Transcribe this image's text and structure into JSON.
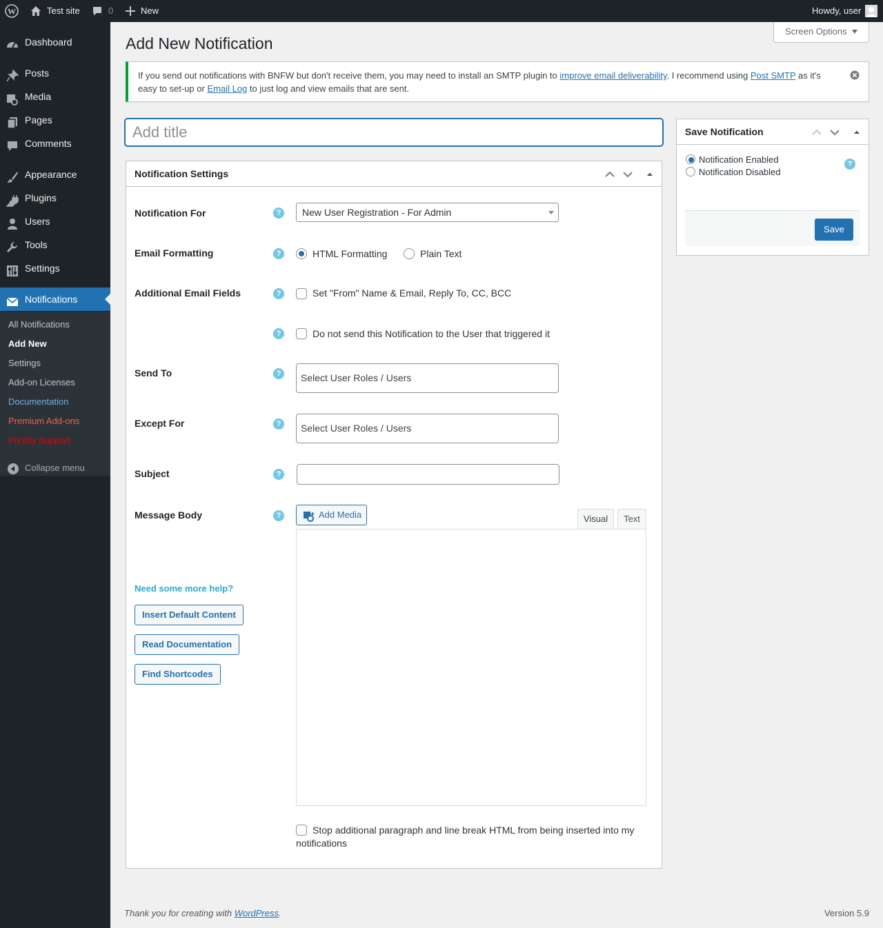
{
  "admin_bar": {
    "wp_logo_icon": "wordpress-icon",
    "site_name": "Test site",
    "comments_count": "0",
    "new_label": "New",
    "greeting": "Howdy, user"
  },
  "sidebar": {
    "items": [
      {
        "label": "Dashboard",
        "icon": "dashboard-icon"
      },
      {
        "label": "Posts",
        "icon": "pin-icon"
      },
      {
        "label": "Media",
        "icon": "media-icon"
      },
      {
        "label": "Pages",
        "icon": "pages-icon"
      },
      {
        "label": "Comments",
        "icon": "comment-icon"
      },
      {
        "label": "Appearance",
        "icon": "brush-icon"
      },
      {
        "label": "Plugins",
        "icon": "plugin-icon"
      },
      {
        "label": "Users",
        "icon": "user-icon"
      },
      {
        "label": "Tools",
        "icon": "wrench-icon"
      },
      {
        "label": "Settings",
        "icon": "settings-icon"
      },
      {
        "label": "Notifications",
        "icon": "envelope-icon"
      }
    ],
    "submenu": [
      "All Notifications",
      "Add New",
      "Settings",
      "Add-on Licenses",
      "Documentation",
      "Premium Add-ons",
      "Priority Support"
    ],
    "collapse_label": "Collapse menu"
  },
  "screen_options_label": "Screen Options",
  "page_title": "Add New Notification",
  "notice": {
    "text_1": "If you send out notifications with BNFW but don't receive them, you may need to install an SMTP plugin to ",
    "link_1": "improve email deliverability",
    "text_2": ". I recommend using ",
    "link_2": "Post SMTP",
    "text_3": " as it's easy to set-up or ",
    "link_3": "Email Log",
    "text_4": " to just log and view emails that are sent."
  },
  "title_placeholder": "Add title",
  "settings_box": {
    "title": "Notification Settings",
    "notification_for_label": "Notification For",
    "notification_for_value": "New User Registration - For Admin",
    "email_formatting_label": "Email Formatting",
    "format_html": "HTML Formatting",
    "format_plain": "Plain Text",
    "additional_fields_label": "Additional Email Fields",
    "additional_fields_option": "Set \"From\" Name & Email, Reply To, CC, BCC",
    "no_trigger_user_option": "Do not send this Notification to the User that triggered it",
    "send_to_label": "Send To",
    "send_to_placeholder": "Select User Roles / Users",
    "except_for_label": "Except For",
    "except_for_placeholder": "Select User Roles / Users",
    "subject_label": "Subject",
    "subject_value": "",
    "message_body_label": "Message Body",
    "add_media_label": "Add Media",
    "tab_visual": "Visual",
    "tab_text": "Text",
    "help_text": "Need some more help?",
    "insert_default_label": "Insert Default Content",
    "read_docs_label": "Read Documentation",
    "find_shortcodes_label": "Find Shortcodes",
    "stop_paragraph_option": "Stop additional paragraph and line break HTML from being inserted into my notifications"
  },
  "save_box": {
    "title": "Save Notification",
    "enabled_label": "Notification Enabled",
    "disabled_label": "Notification Disabled",
    "save_label": "Save"
  },
  "footer": {
    "thanks_text": "Thank you for creating with ",
    "wp_link": "WordPress",
    "thanks_end": ".",
    "version": "Version 5.9"
  },
  "colors": {
    "admin_dark": "#1d2327",
    "accent_blue": "#2271b1",
    "notice_green": "#00a32a",
    "help_icon": "#72c6e6"
  }
}
